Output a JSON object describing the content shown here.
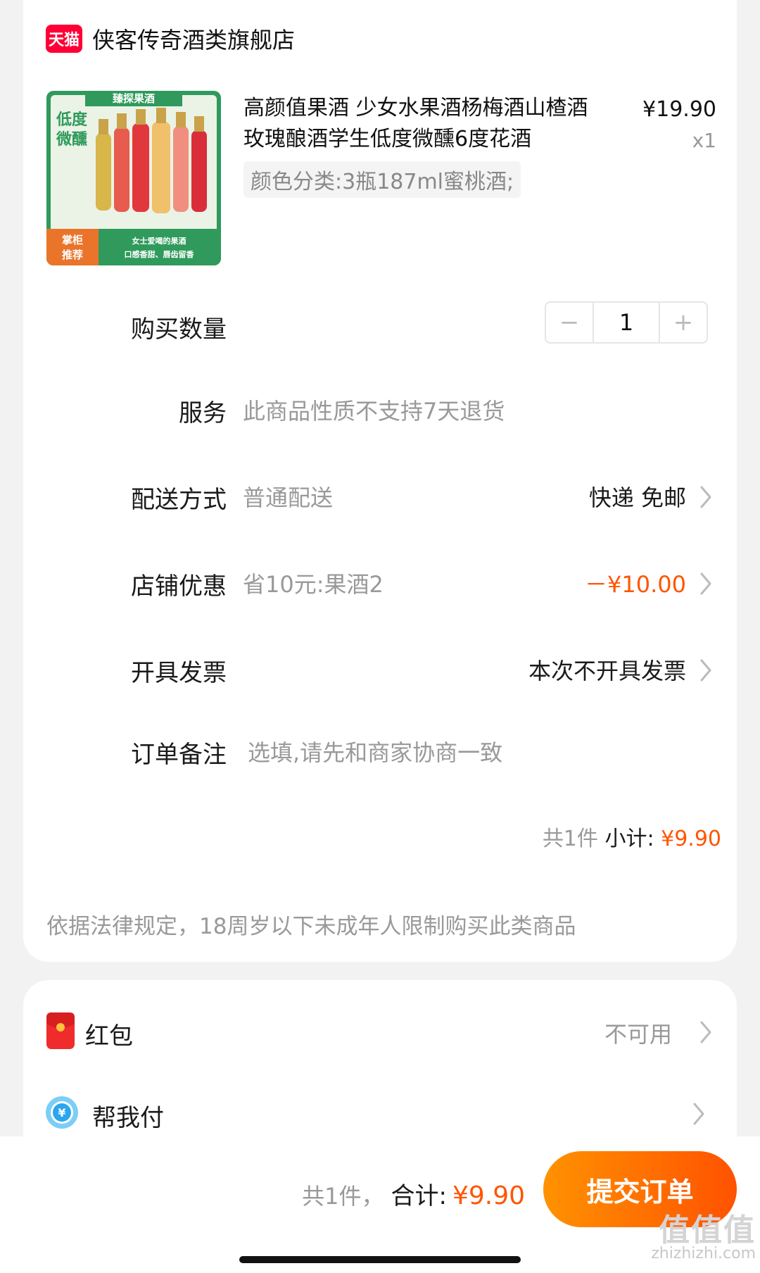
{
  "shop": {
    "badge": "天猫",
    "name": "侠客传奇酒类旗舰店"
  },
  "product": {
    "image_text": {
      "top": "臻探果酒",
      "side": "低度\n微醺",
      "corner": "掌柜\n推荐",
      "bottom": "女士爱喝的果酒\n口感香甜、唇齿留香"
    },
    "title": "高颜值果酒 少女水果酒杨梅酒山楂酒玫瑰酿酒学生低度微醺6度花酒",
    "price": "¥19.90",
    "quantity": "x1",
    "sku": "颜色分类:3瓶187ml蜜桃酒;"
  },
  "purchase_qty": {
    "label": "购买数量",
    "minus": "−",
    "value": "1",
    "plus": "+"
  },
  "service": {
    "label": "服务",
    "value": "此商品性质不支持7天退货"
  },
  "delivery": {
    "label": "配送方式",
    "value": "普通配送",
    "right": "快递 免邮"
  },
  "discount": {
    "label": "店铺优惠",
    "value": "省10元:果酒2",
    "right": "－¥10.00"
  },
  "invoice": {
    "label": "开具发票",
    "right": "本次不开具发票"
  },
  "remark": {
    "label": "订单备注",
    "placeholder": "选填,请先和商家协商一致"
  },
  "subtotal": {
    "count": "共1件",
    "label": "小计:",
    "amount": "¥9.90"
  },
  "notice": "依据法律规定，18周岁以下未成年人限制购买此类商品",
  "red_packet": {
    "label": "红包",
    "status": "不可用"
  },
  "pay_for_me": {
    "label": "帮我付"
  },
  "bottom": {
    "count": "共1件，",
    "label": "合计:",
    "amount": "¥9.90",
    "submit": "提交订单"
  },
  "watermark": {
    "brand": "值值值",
    "url": "zhizhizhi.com"
  },
  "colors": {
    "accent": "#ff5500",
    "tmall": "#ff0036",
    "button_start": "#ff9200",
    "button_end": "#ff5200"
  }
}
